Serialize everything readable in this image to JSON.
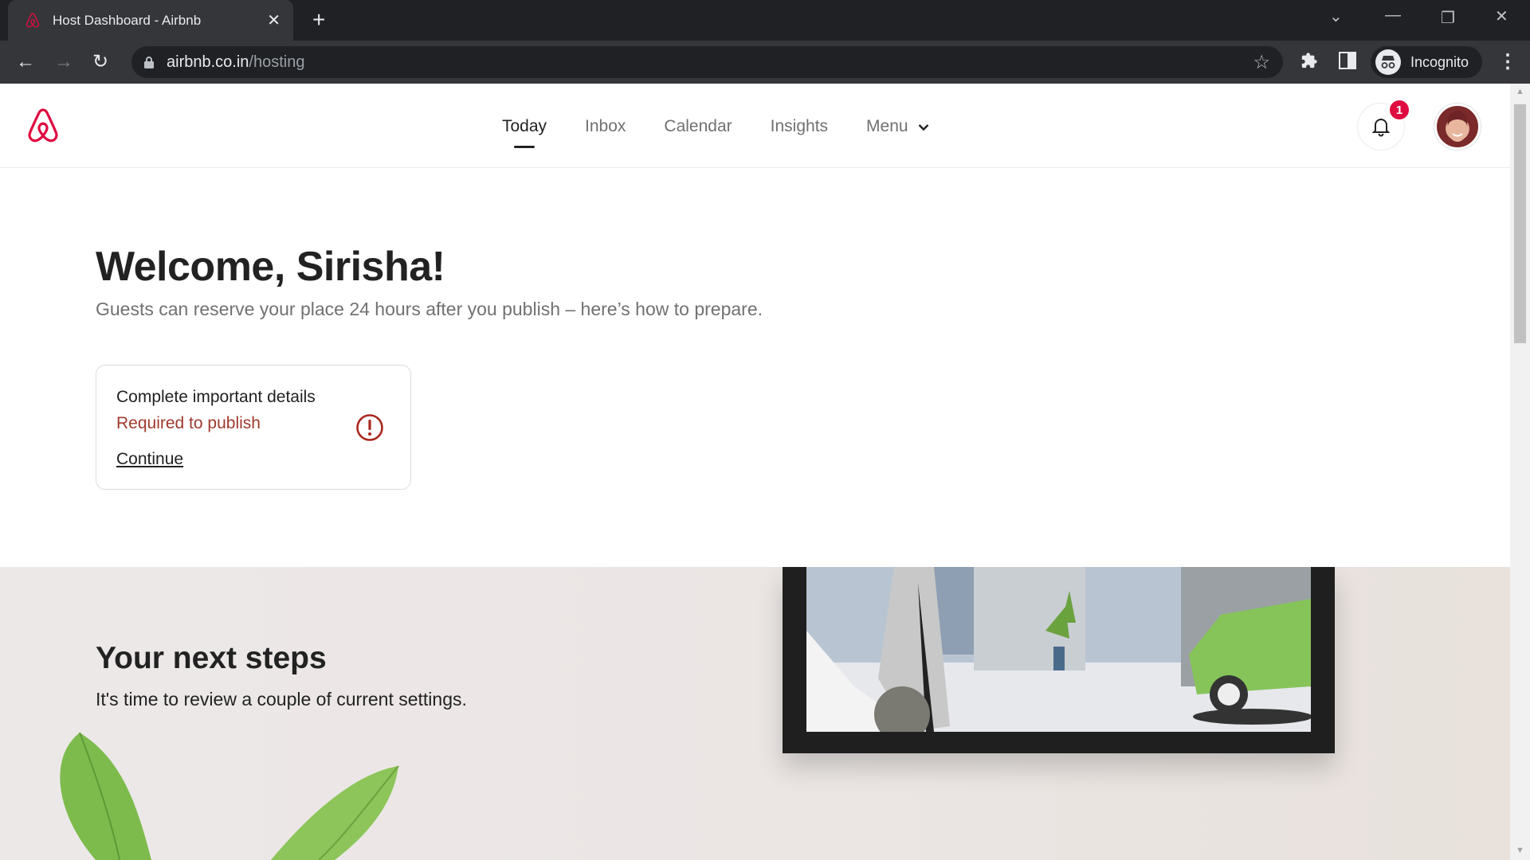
{
  "browser": {
    "tab_title": "Host Dashboard - Airbnb",
    "tab_favicon": "airbnb-logo-icon",
    "url_host": "airbnb.co.in",
    "url_path": "/hosting",
    "profile_label": "Incognito",
    "icons": [
      "back-icon",
      "forward-icon",
      "reload-icon",
      "lock-icon",
      "star-icon",
      "extensions-icon",
      "side-panel-icon",
      "incognito-icon",
      "more-icon",
      "tab-search-icon",
      "minimize-icon",
      "restore-icon",
      "close-icon"
    ]
  },
  "header": {
    "brand_color": "#e00b41",
    "nav": [
      {
        "label": "Today",
        "active": true
      },
      {
        "label": "Inbox",
        "active": false
      },
      {
        "label": "Calendar",
        "active": false
      },
      {
        "label": "Insights",
        "active": false
      },
      {
        "label": "Menu",
        "active": false,
        "dropdown": true
      }
    ],
    "notification_count": "1"
  },
  "main": {
    "welcome_title": "Welcome, Sirisha!",
    "welcome_subtitle": "Guests can reserve your place 24 hours after you publish – here’s how to prepare.",
    "task_card": {
      "title": "Complete important details",
      "status": "Required to publish",
      "status_color": "#a03a2e",
      "action_label": "Continue"
    }
  },
  "next_steps": {
    "title": "Your next steps",
    "subtitle": "It's time to review a couple of current settings."
  }
}
